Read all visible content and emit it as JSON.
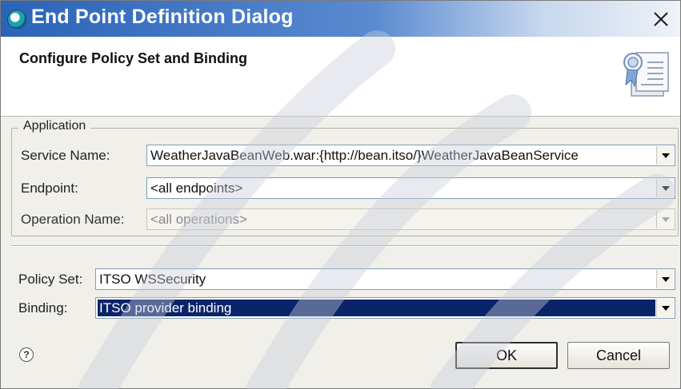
{
  "window": {
    "title": "End Point Definition Dialog",
    "close_glyph": "✕"
  },
  "banner": {
    "title": "Configure Policy Set and Binding",
    "art_icon": "policy-document-icon"
  },
  "application_group": {
    "label": "Application",
    "service_name": {
      "label": "Service Name:",
      "value": "WeatherJavaBeanWeb.war:{http://bean.itso/}WeatherJavaBeanService"
    },
    "endpoint": {
      "label": "Endpoint:",
      "value": "<all endpoints>"
    },
    "operation_name": {
      "label": "Operation Name:",
      "value": "<all operations>",
      "enabled": false
    }
  },
  "policy": {
    "policy_set": {
      "label": "Policy Set:",
      "value": "ITSO WSSecurity"
    },
    "binding": {
      "label": "Binding:",
      "value": "ITSO provider binding",
      "selected": true
    }
  },
  "footer": {
    "help_glyph": "?",
    "ok_label": "OK",
    "cancel_label": "Cancel"
  },
  "colors": {
    "titlebar_start": "#2a63b8",
    "selection": "#0a246a",
    "watermark": "#d0d4e0"
  }
}
